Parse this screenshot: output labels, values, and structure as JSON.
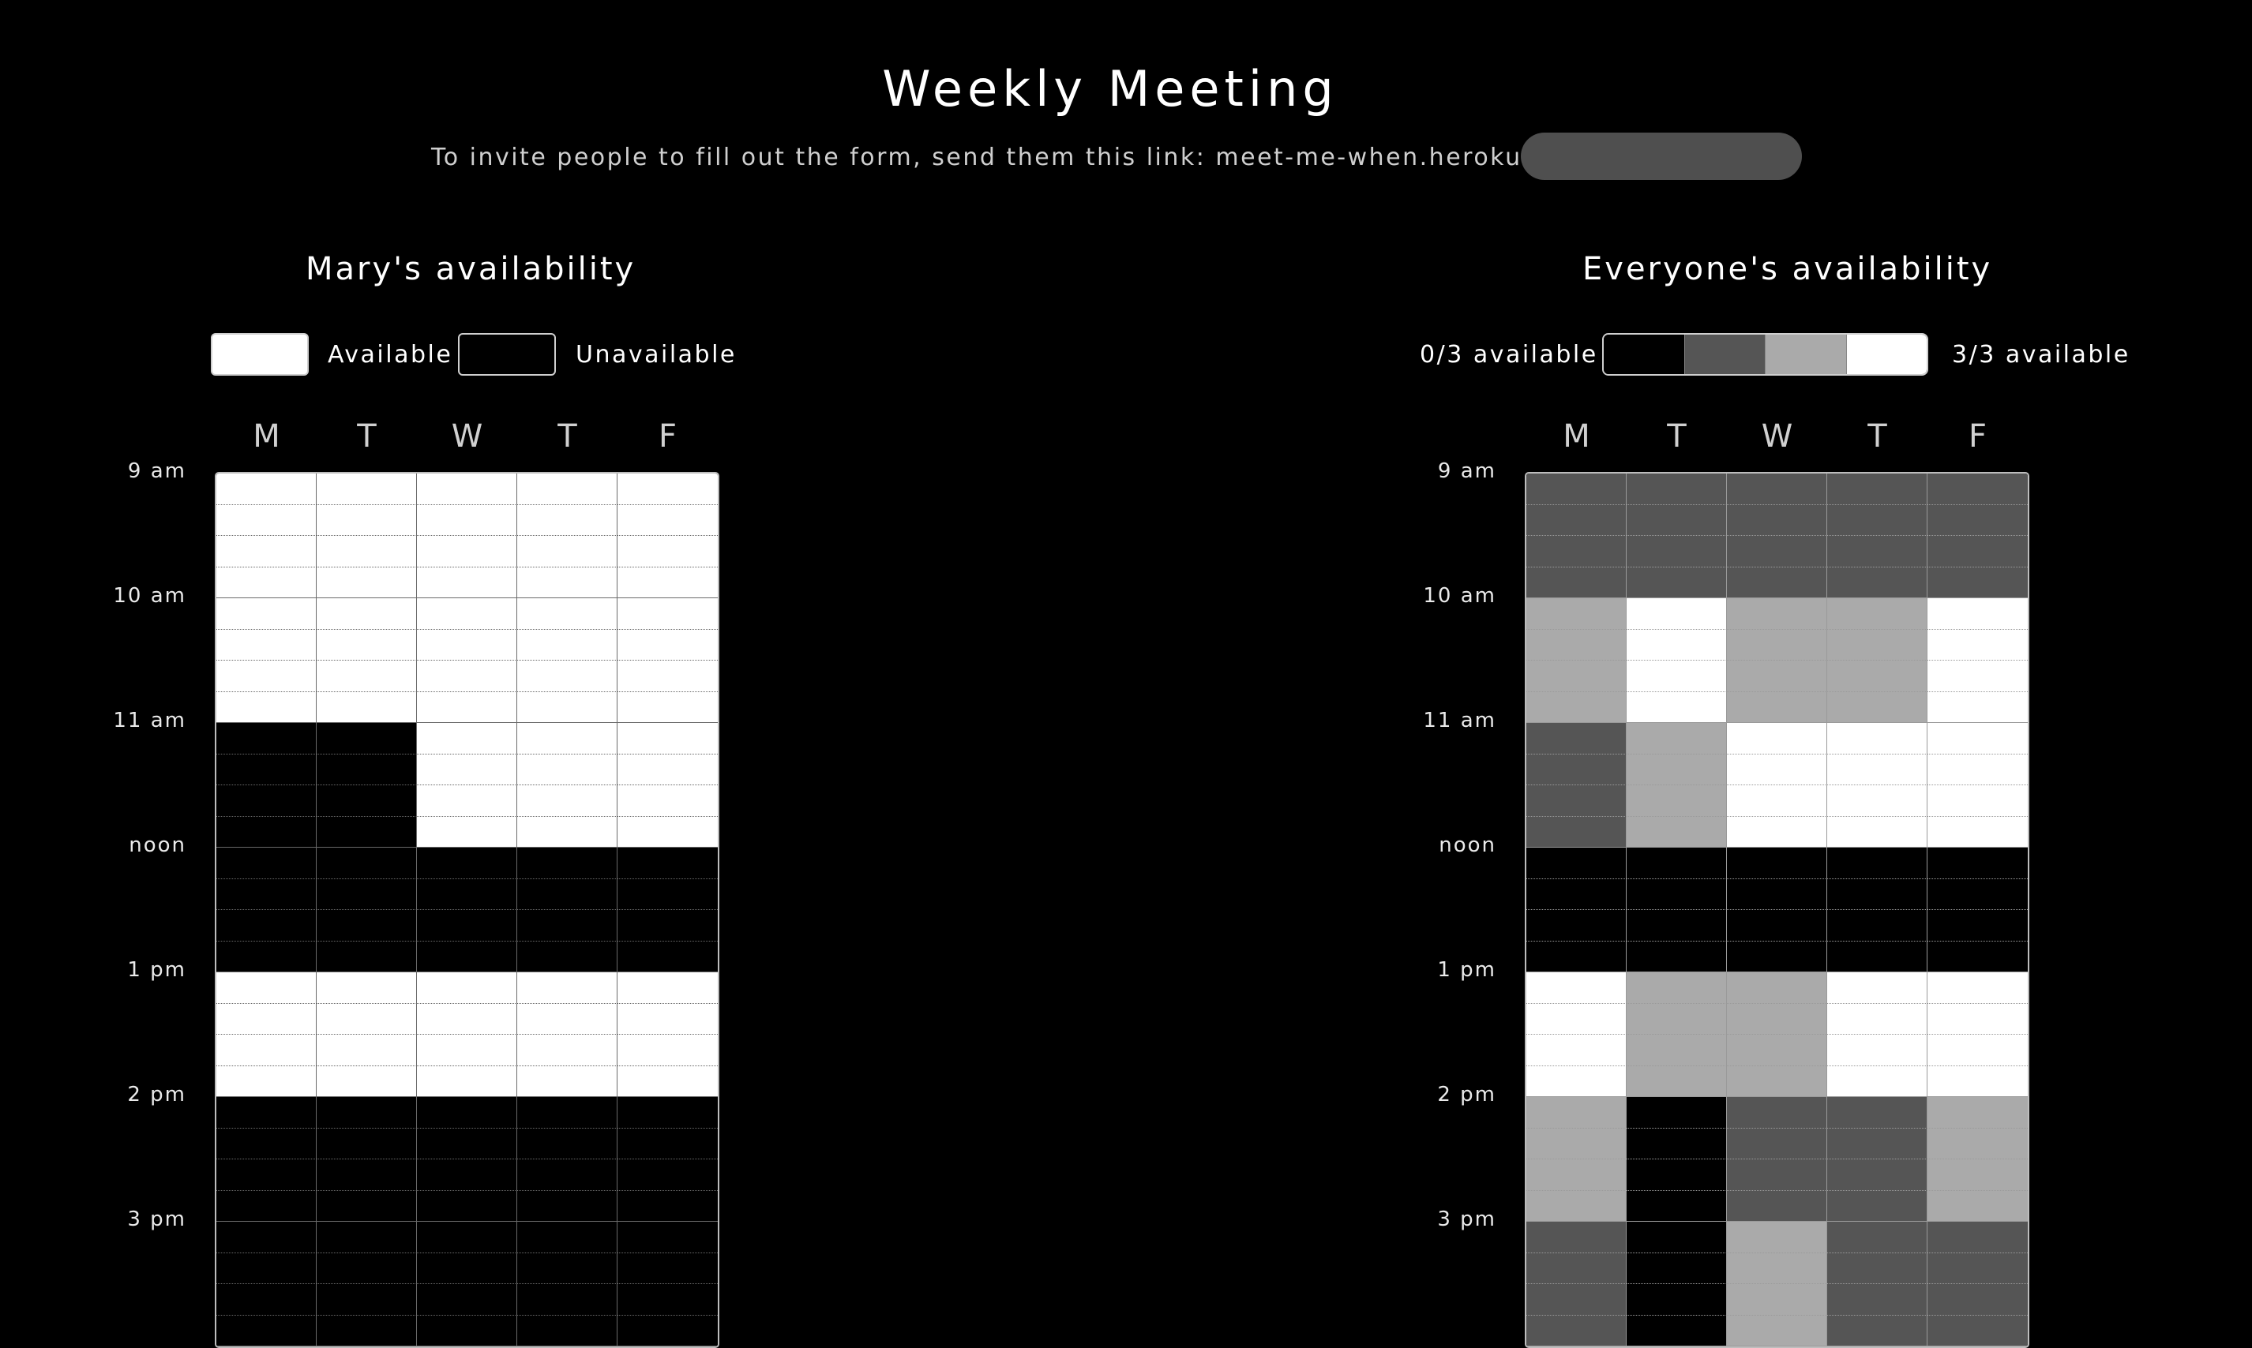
{
  "page": {
    "title": "Weekly Meeting",
    "invite_text": "To invite people to fill out the form, send them this link: meet-me-when.herokuapp.com/"
  },
  "personal": {
    "title": "Mary's availability",
    "legend_available": "Available",
    "legend_unavailable": "Unavailable",
    "days": [
      "M",
      "T",
      "W",
      "T",
      "F"
    ],
    "hours": [
      "9 am",
      "10 am",
      "11 am",
      "noon",
      "1 pm",
      "2 pm",
      "3 pm"
    ],
    "slots": [
      [
        1,
        1,
        1,
        1,
        1
      ],
      [
        1,
        1,
        1,
        1,
        1
      ],
      [
        1,
        1,
        1,
        1,
        1
      ],
      [
        1,
        1,
        1,
        1,
        1
      ],
      [
        1,
        1,
        1,
        1,
        1
      ],
      [
        1,
        1,
        1,
        1,
        1
      ],
      [
        1,
        1,
        1,
        1,
        1
      ],
      [
        1,
        1,
        1,
        1,
        1
      ],
      [
        0,
        0,
        1,
        1,
        1
      ],
      [
        0,
        0,
        1,
        1,
        1
      ],
      [
        0,
        0,
        1,
        1,
        1
      ],
      [
        0,
        0,
        1,
        1,
        1
      ],
      [
        0,
        0,
        0,
        0,
        0
      ],
      [
        0,
        0,
        0,
        0,
        0
      ],
      [
        0,
        0,
        0,
        0,
        0
      ],
      [
        0,
        0,
        0,
        0,
        0
      ],
      [
        1,
        1,
        1,
        1,
        1
      ],
      [
        1,
        1,
        1,
        1,
        1
      ],
      [
        1,
        1,
        1,
        1,
        1
      ],
      [
        1,
        1,
        1,
        1,
        1
      ],
      [
        0,
        0,
        0,
        0,
        0
      ],
      [
        0,
        0,
        0,
        0,
        0
      ],
      [
        0,
        0,
        0,
        0,
        0
      ],
      [
        0,
        0,
        0,
        0,
        0
      ],
      [
        0,
        0,
        0,
        0,
        0
      ],
      [
        0,
        0,
        0,
        0,
        0
      ],
      [
        0,
        0,
        0,
        0,
        0
      ],
      [
        0,
        0,
        0,
        0,
        0
      ]
    ]
  },
  "group": {
    "title": "Everyone's availability",
    "legend_min": "0/3 available",
    "legend_max": "3/3 available",
    "total": 3,
    "days": [
      "M",
      "T",
      "W",
      "T",
      "F"
    ],
    "hours": [
      "9 am",
      "10 am",
      "11 am",
      "noon",
      "1 pm",
      "2 pm",
      "3 pm"
    ],
    "counts": [
      [
        1,
        1,
        1,
        1,
        1
      ],
      [
        1,
        1,
        1,
        1,
        1
      ],
      [
        1,
        1,
        1,
        1,
        1
      ],
      [
        1,
        1,
        1,
        1,
        1
      ],
      [
        2,
        3,
        2,
        2,
        3
      ],
      [
        2,
        3,
        2,
        2,
        3
      ],
      [
        2,
        3,
        2,
        2,
        3
      ],
      [
        2,
        3,
        2,
        2,
        3
      ],
      [
        1,
        2,
        3,
        3,
        3
      ],
      [
        1,
        2,
        3,
        3,
        3
      ],
      [
        1,
        2,
        3,
        3,
        3
      ],
      [
        1,
        2,
        3,
        3,
        3
      ],
      [
        0,
        0,
        0,
        0,
        0
      ],
      [
        0,
        0,
        0,
        0,
        0
      ],
      [
        0,
        0,
        0,
        0,
        0
      ],
      [
        0,
        0,
        0,
        0,
        0
      ],
      [
        3,
        2,
        2,
        3,
        3
      ],
      [
        3,
        2,
        2,
        3,
        3
      ],
      [
        3,
        2,
        2,
        3,
        3
      ],
      [
        3,
        2,
        2,
        3,
        3
      ],
      [
        2,
        0,
        1,
        1,
        2
      ],
      [
        2,
        0,
        1,
        1,
        2
      ],
      [
        2,
        0,
        1,
        1,
        2
      ],
      [
        2,
        0,
        1,
        1,
        2
      ],
      [
        1,
        0,
        2,
        1,
        1
      ],
      [
        1,
        0,
        2,
        1,
        1
      ],
      [
        1,
        0,
        2,
        1,
        1
      ],
      [
        1,
        0,
        2,
        1,
        1
      ]
    ]
  },
  "colors": {
    "available": "#ffffff",
    "unavailable": "#000000",
    "count_scale": [
      "#000000",
      "#555555",
      "#aaaaaa",
      "#ffffff"
    ]
  }
}
